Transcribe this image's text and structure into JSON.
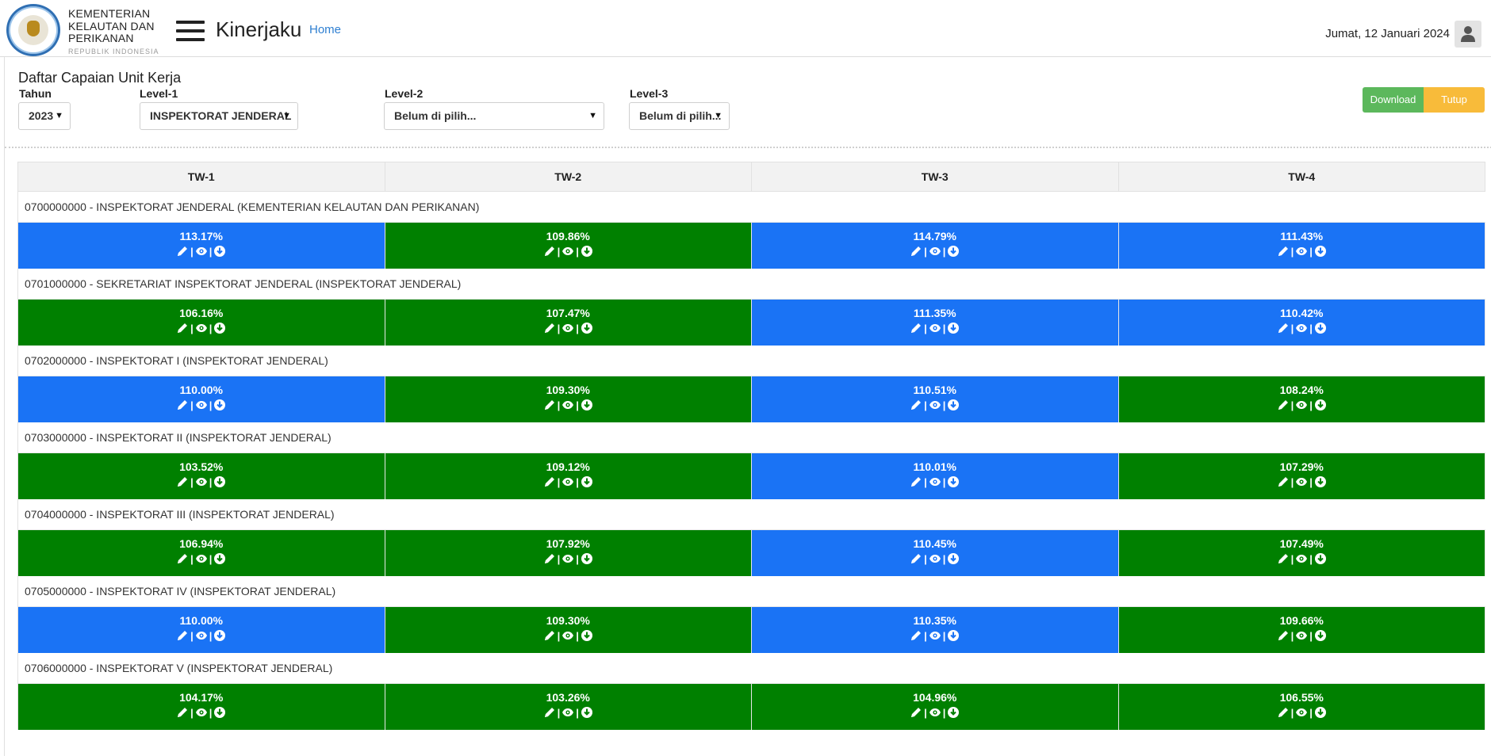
{
  "header": {
    "org_line1": "KEMENTERIAN",
    "org_line2": "KELAUTAN DAN",
    "org_line3": "PERIKANAN",
    "org_sub": "REPUBLIK INDONESIA",
    "app_title": "Kinerjaku",
    "home_link": "Home",
    "date": "Jumat, 12 Januari 2024"
  },
  "panel": {
    "title": "Daftar Capaian Unit Kerja",
    "filters": {
      "tahun_label": "Tahun",
      "tahun_value": "2023",
      "level1_label": "Level-1",
      "level1_value": "INSPEKTORAT JENDERAL",
      "level2_label": "Level-2",
      "level2_value": "Belum di pilih...",
      "level3_label": "Level-3",
      "level3_value": "Belum di pilih..."
    },
    "buttons": {
      "download": "Download",
      "close": "Tutup"
    }
  },
  "colors": {
    "above_target": "#1a73f5",
    "on_target": "#008000",
    "download": "#5cb85c",
    "close": "#f8bb3a"
  },
  "table": {
    "headers": [
      "TW-1",
      "TW-2",
      "TW-3",
      "TW-4"
    ],
    "action_icons": [
      "pencil-icon",
      "eye-icon",
      "download-circle-icon"
    ],
    "separator": "|",
    "units": [
      {
        "name": "0700000000 - INSPEKTORAT JENDERAL (KEMENTERIAN KELAUTAN DAN PERIKANAN)",
        "values": [
          {
            "pct": "113.17%",
            "color": "blue"
          },
          {
            "pct": "109.86%",
            "color": "green"
          },
          {
            "pct": "114.79%",
            "color": "blue"
          },
          {
            "pct": "111.43%",
            "color": "blue"
          }
        ]
      },
      {
        "name": "0701000000 - SEKRETARIAT INSPEKTORAT JENDERAL (INSPEKTORAT JENDERAL)",
        "values": [
          {
            "pct": "106.16%",
            "color": "green"
          },
          {
            "pct": "107.47%",
            "color": "green"
          },
          {
            "pct": "111.35%",
            "color": "blue"
          },
          {
            "pct": "110.42%",
            "color": "blue"
          }
        ]
      },
      {
        "name": "0702000000 - INSPEKTORAT I (INSPEKTORAT JENDERAL)",
        "values": [
          {
            "pct": "110.00%",
            "color": "blue"
          },
          {
            "pct": "109.30%",
            "color": "green"
          },
          {
            "pct": "110.51%",
            "color": "blue"
          },
          {
            "pct": "108.24%",
            "color": "green"
          }
        ]
      },
      {
        "name": "0703000000 - INSPEKTORAT II (INSPEKTORAT JENDERAL)",
        "values": [
          {
            "pct": "103.52%",
            "color": "green"
          },
          {
            "pct": "109.12%",
            "color": "green"
          },
          {
            "pct": "110.01%",
            "color": "blue"
          },
          {
            "pct": "107.29%",
            "color": "green"
          }
        ]
      },
      {
        "name": "0704000000 - INSPEKTORAT III (INSPEKTORAT JENDERAL)",
        "values": [
          {
            "pct": "106.94%",
            "color": "green"
          },
          {
            "pct": "107.92%",
            "color": "green"
          },
          {
            "pct": "110.45%",
            "color": "blue"
          },
          {
            "pct": "107.49%",
            "color": "green"
          }
        ]
      },
      {
        "name": "0705000000 - INSPEKTORAT IV (INSPEKTORAT JENDERAL)",
        "values": [
          {
            "pct": "110.00%",
            "color": "blue"
          },
          {
            "pct": "109.30%",
            "color": "green"
          },
          {
            "pct": "110.35%",
            "color": "blue"
          },
          {
            "pct": "109.66%",
            "color": "green"
          }
        ]
      },
      {
        "name": "0706000000 - INSPEKTORAT V (INSPEKTORAT JENDERAL)",
        "values": [
          {
            "pct": "104.17%",
            "color": "green"
          },
          {
            "pct": "103.26%",
            "color": "green"
          },
          {
            "pct": "104.96%",
            "color": "green"
          },
          {
            "pct": "106.55%",
            "color": "green"
          }
        ]
      }
    ]
  }
}
